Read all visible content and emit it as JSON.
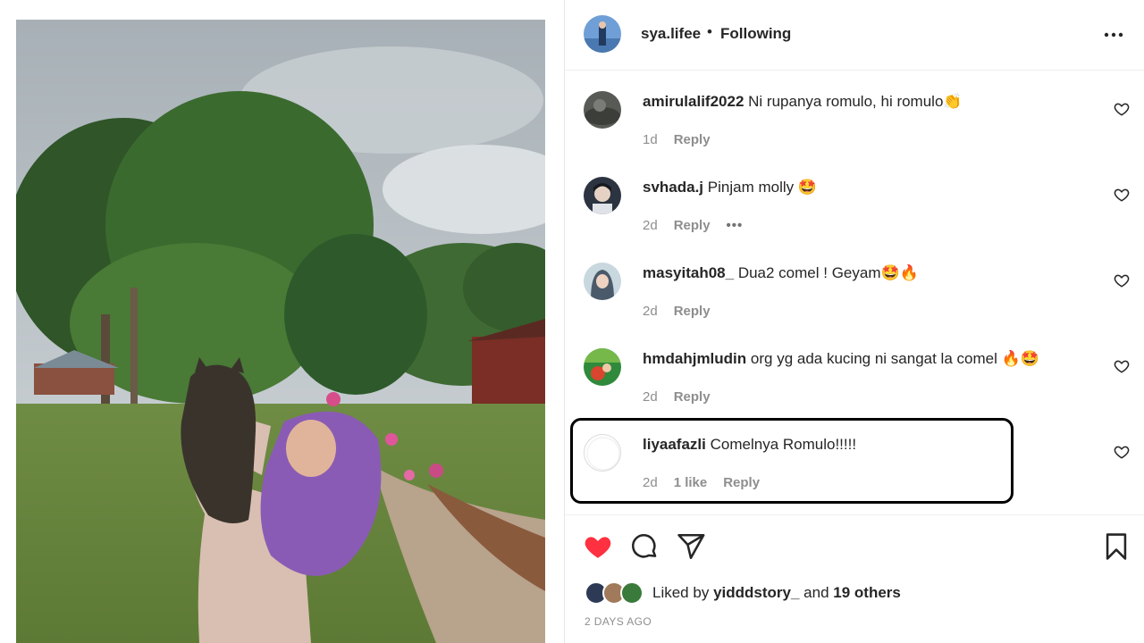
{
  "post": {
    "username": "sya.lifee",
    "separator": "•",
    "follow_status": "Following"
  },
  "comments": [
    {
      "username": "amirulalif2022",
      "text": "Ni rupanya romulo, hi romulo👏",
      "time": "1d",
      "likes": "",
      "reply": "Reply",
      "more": ""
    },
    {
      "username": "svhada.j",
      "text": "Pinjam molly 🤩",
      "time": "2d",
      "likes": "",
      "reply": "Reply",
      "more": "•••"
    },
    {
      "username": "masyitah08_",
      "text": "Dua2 comel ! Geyam🤩🔥",
      "time": "2d",
      "likes": "",
      "reply": "Reply",
      "more": ""
    },
    {
      "username": "hmdahjmludin",
      "text": "org yg ada kucing ni sangat la comel 🔥🤩",
      "time": "2d",
      "likes": "",
      "reply": "Reply",
      "more": ""
    },
    {
      "username": "liyaafazli",
      "text": "Comelnya Romulo!!!!!",
      "time": "2d",
      "likes": "1 like",
      "reply": "Reply",
      "more": ""
    }
  ],
  "likes": {
    "prefix": "Liked by",
    "user": "yidddstory_",
    "conjunction": "and",
    "others": "19 others"
  },
  "date": "2 DAYS AGO",
  "icons": [
    "more-icon",
    "heart-icon",
    "comment-icon",
    "share-icon",
    "save-icon"
  ],
  "colors": {
    "like_red": "#ff3040",
    "text": "#262626",
    "secondary": "#8e8e8e",
    "highlight": "#000000"
  }
}
